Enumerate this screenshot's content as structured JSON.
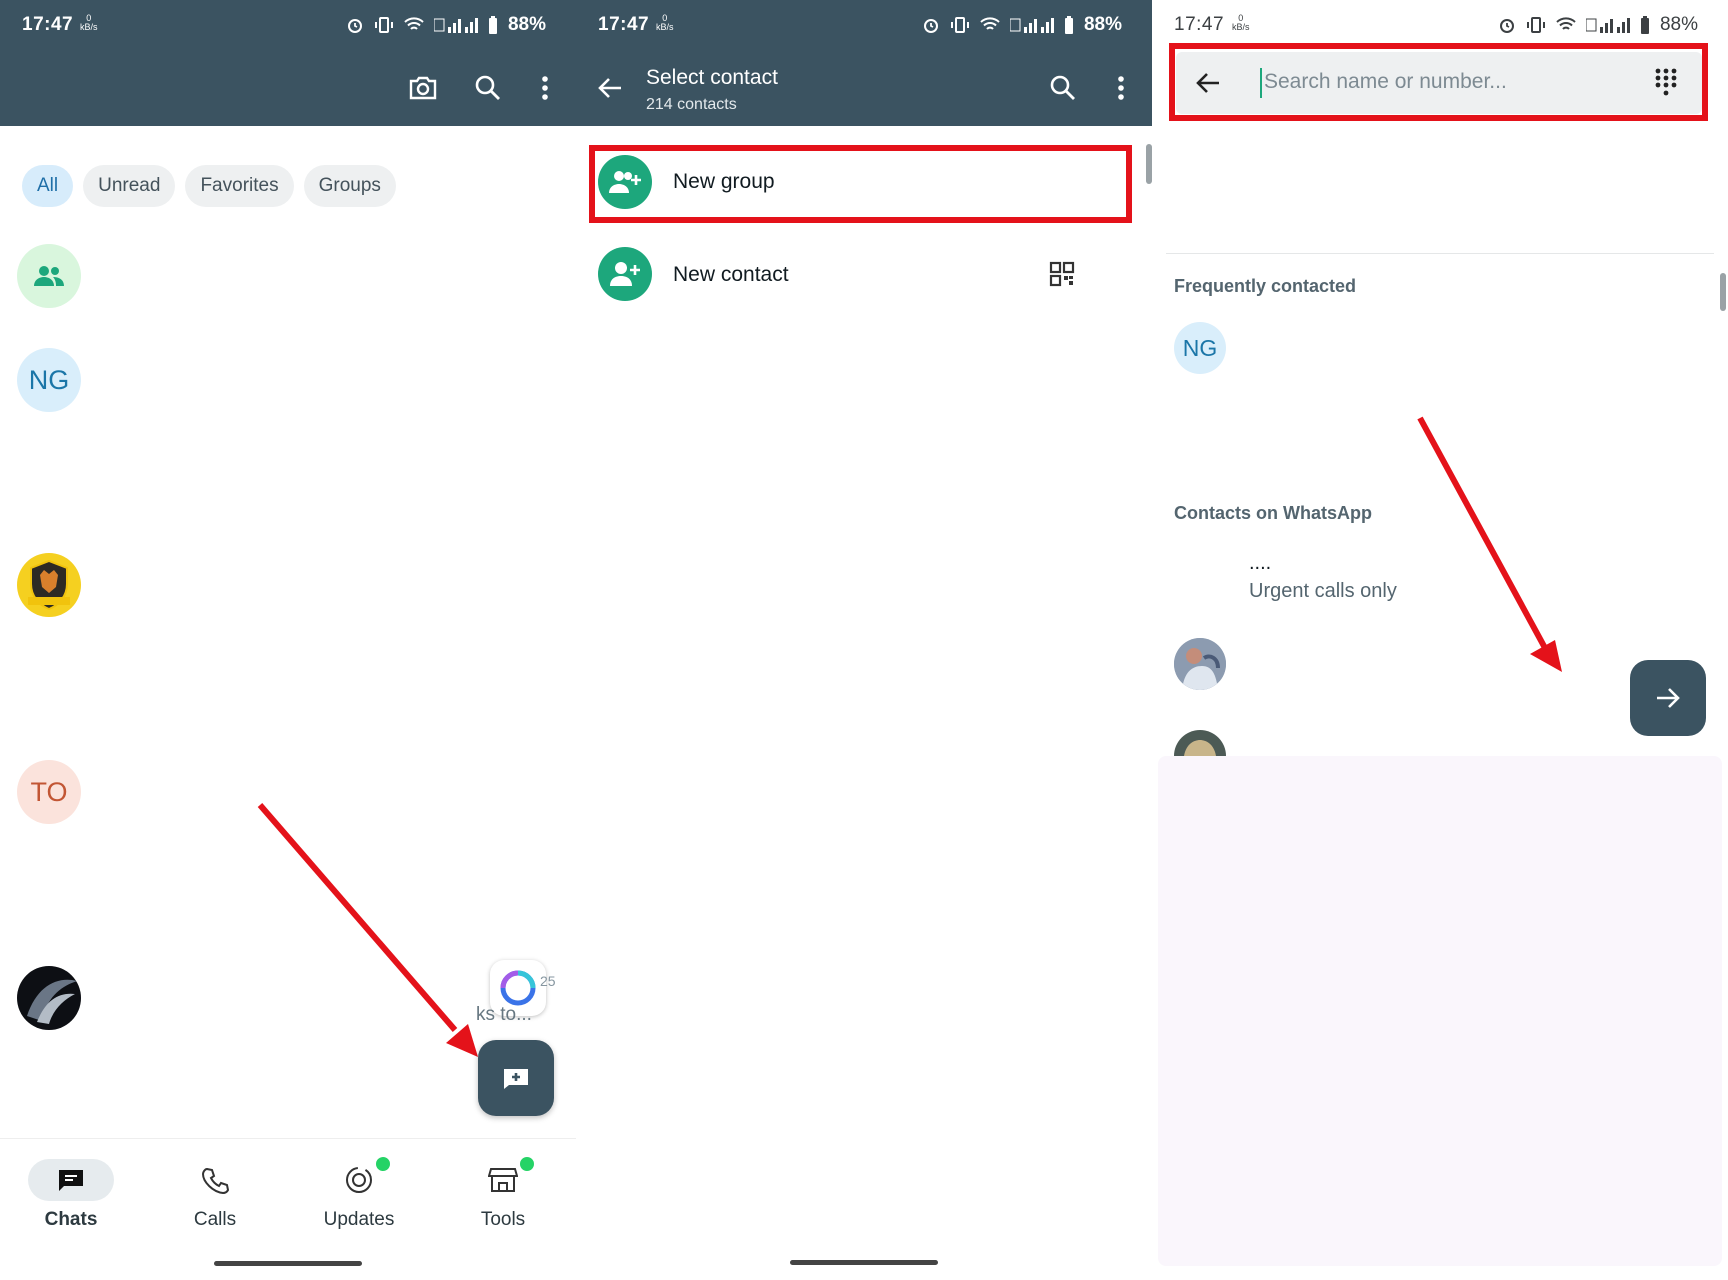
{
  "status": {
    "time": "17:47",
    "net_speed_value": "0",
    "net_speed_unit": "kB/s",
    "battery": "88%"
  },
  "panel1": {
    "filters": [
      "All",
      "Unread",
      "Favorites",
      "Groups"
    ],
    "avatars": {
      "ng": "NG",
      "to": "TO"
    },
    "partial_text": {
      "time_fragment": "25",
      "preview_fragment": "ks to..."
    },
    "nav": {
      "chats": "Chats",
      "calls": "Calls",
      "updates": "Updates",
      "tools": "Tools"
    }
  },
  "panel2": {
    "title": "Select contact",
    "subtitle": "214 contacts",
    "new_group": "New group",
    "new_contact": "New contact"
  },
  "panel3": {
    "search_placeholder": "Search name or number...",
    "frequently_contacted": "Frequently contacted",
    "contacts_on_whatsapp": "Contacts on WhatsApp",
    "freq_avatar": "NG",
    "contact1_name": "....",
    "contact1_status": "Urgent calls only"
  },
  "colors": {
    "header": "#3b5361",
    "accent_green": "#1da77c",
    "annotation_red": "#e4121a",
    "badge_green": "#25d366"
  }
}
